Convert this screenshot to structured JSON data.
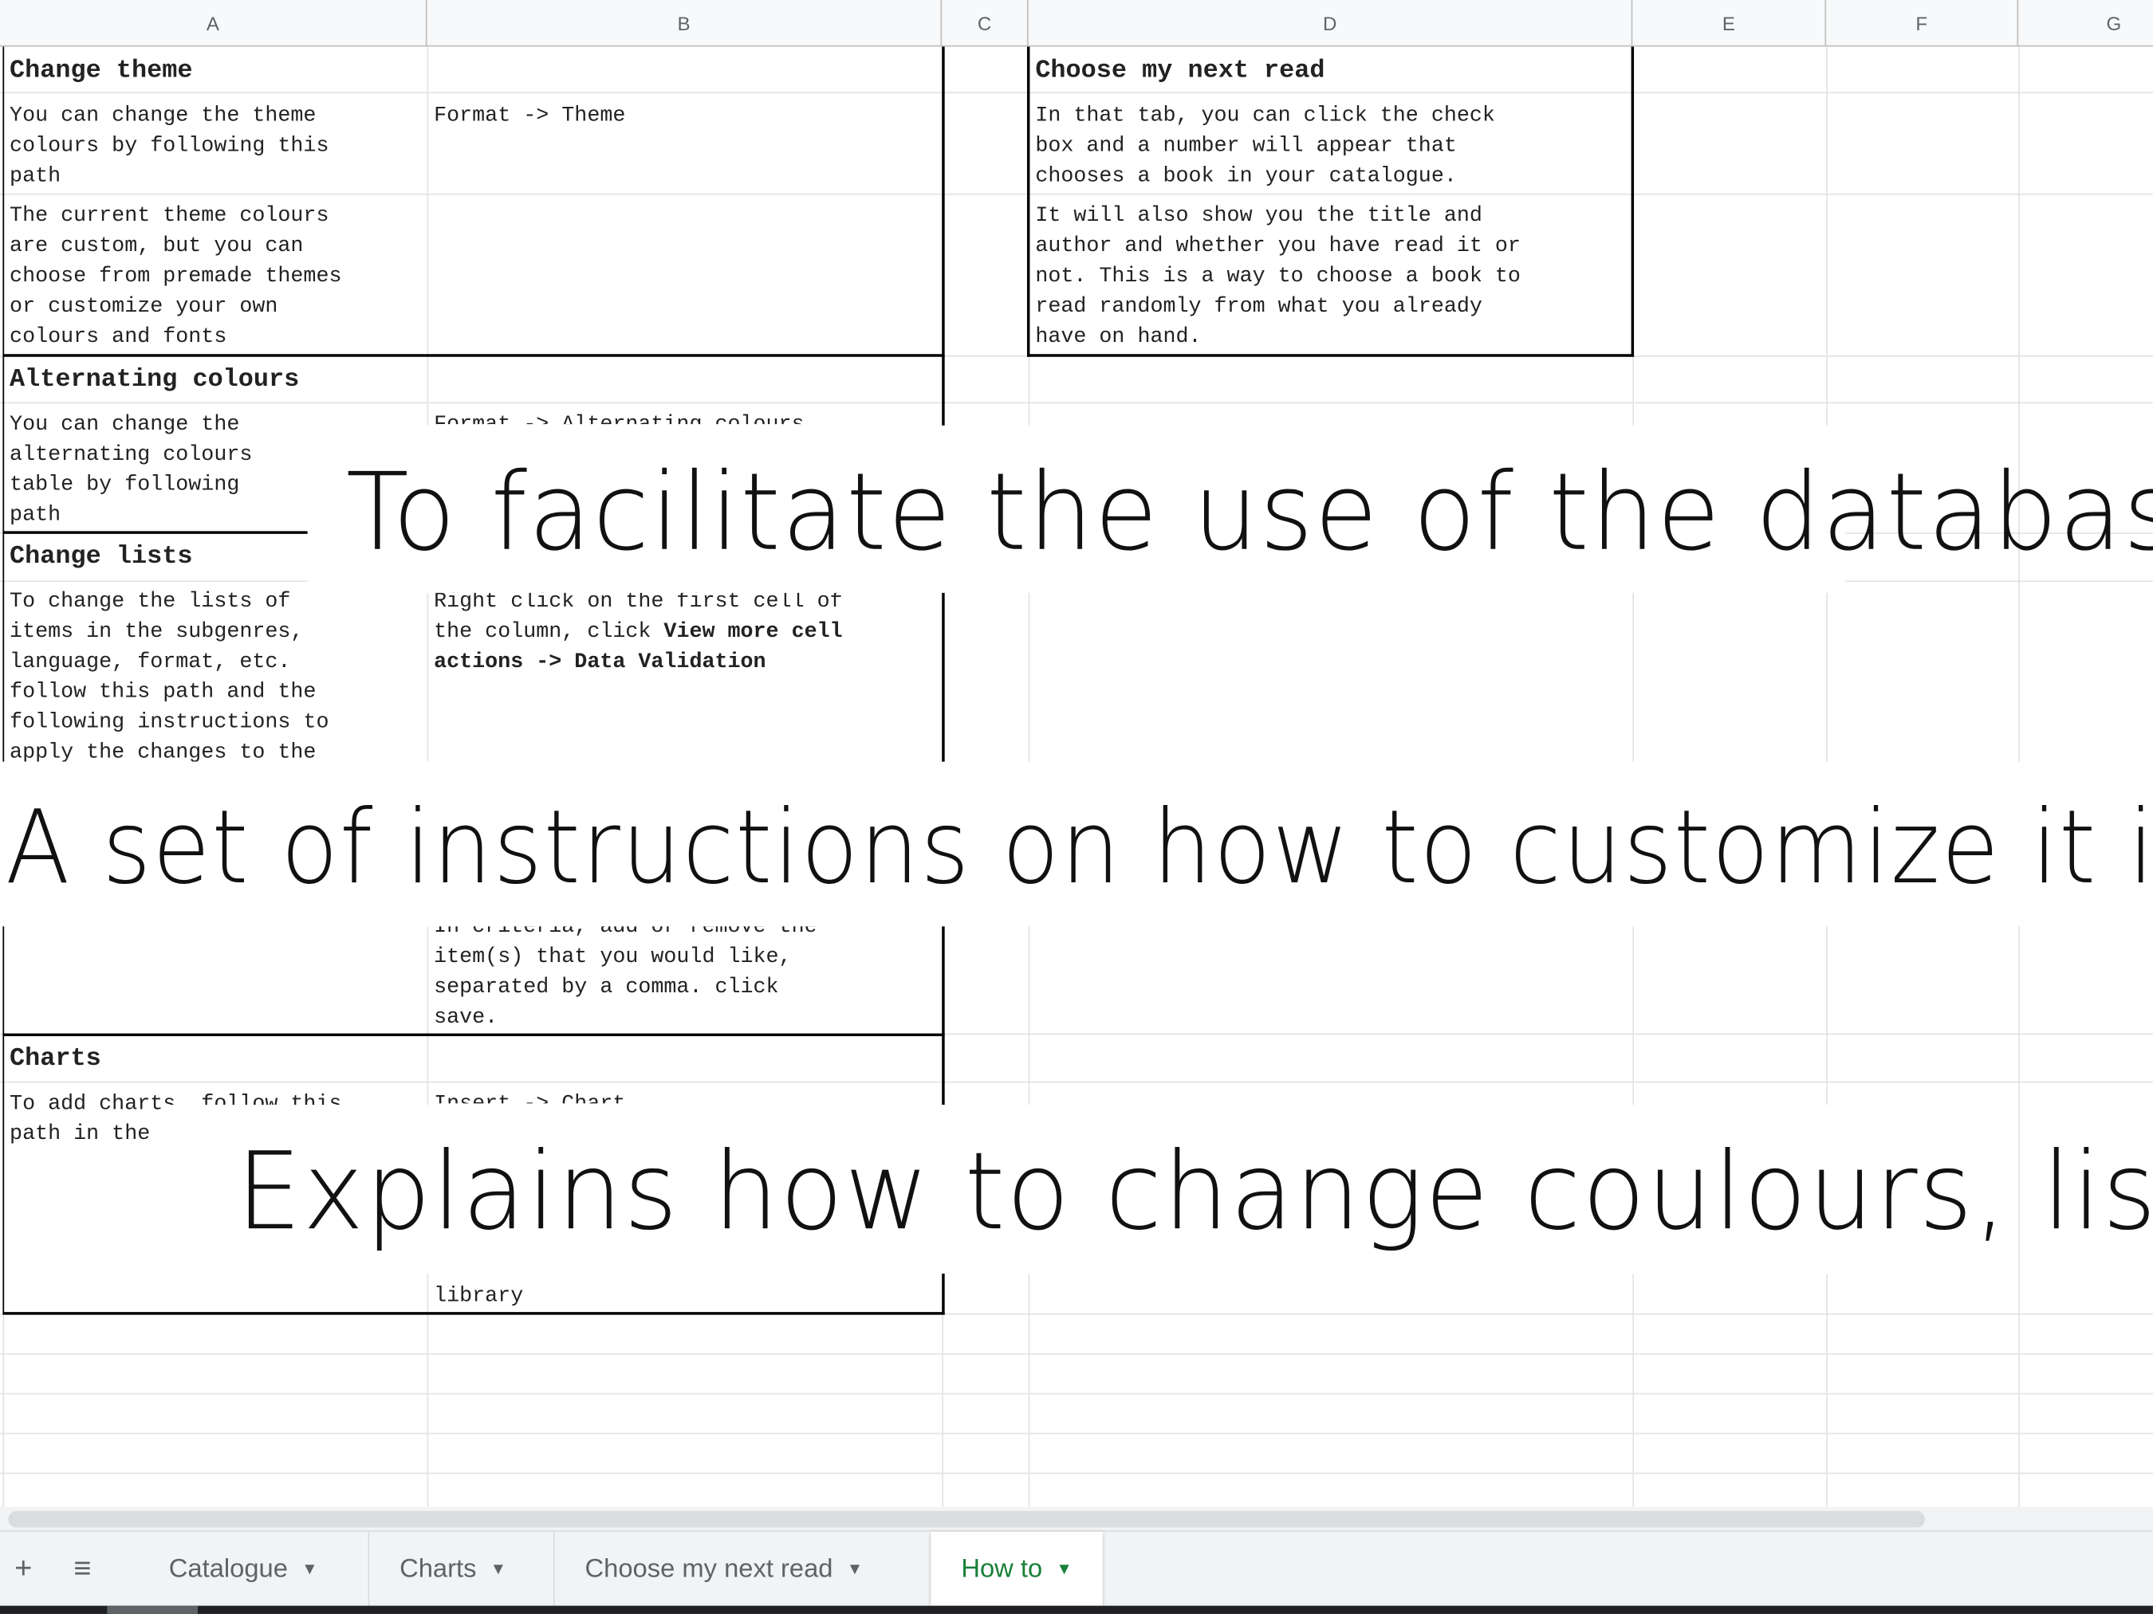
{
  "columns": [
    "A",
    "B",
    "C",
    "D",
    "E",
    "F",
    "G"
  ],
  "instructions": {
    "change_theme": {
      "heading": "Change theme",
      "desc": "You can change the theme\ncolours by following this\npath",
      "path": "Format -> Theme",
      "note": "The current theme colours\nare custom, but you can\nchoose from premade themes\nor customize your own\ncolours and fonts"
    },
    "alternating": {
      "heading": "Alternating colours",
      "desc": "You can change the\nalternating colours\ntable by following \npath",
      "path_fragment": "Format -> Alternating colours"
    },
    "change_lists": {
      "heading": "Change lists",
      "desc": "To change the lists of\nitems in the subgenres,\nlanguage, format, etc.\nfollow this path and the\nfollowing instructions to\napply the changes to the",
      "path_line1": "Right click on the first cell of\nthe column, click ",
      "path_bold1": "View more cell",
      "path_bold2": "actions -> Data Validation",
      "criteria": "In criteria, add or remove the\nitem(s) that you would like,\nseparated by a comma. click\nsave."
    },
    "charts": {
      "heading": "Charts",
      "desc": "To add charts, follow this\npath in the '",
      "path": "Insert -> Chart",
      "tail": "library"
    },
    "next_read": {
      "heading": "Choose my next read",
      "desc1": "In that tab, you can click the check\nbox and a number will appear that\nchooses a book in your catalogue.",
      "desc2": "It will also show you the title and\nauthor and whether you have read it or\nnot. This is a way to choose a book to\nread randomly from what you already\nhave on hand."
    }
  },
  "banners": {
    "line1": "To facilitate the use of the database",
    "line2": "A set of instructions on how to customize it is included",
    "line3": "Explains how to change coulours, lists, etc."
  },
  "sheet_tabs": [
    {
      "label": "Catalogue",
      "active": false
    },
    {
      "label": "Charts",
      "active": false
    },
    {
      "label": "Choose my next read",
      "active": false
    },
    {
      "label": "How to",
      "active": true
    }
  ],
  "icons": {
    "add": "plus-icon",
    "all_sheets": "list-icon",
    "caret": "caret-down-icon"
  },
  "colors": {
    "active_tab": "#188038",
    "header_bg": "#f8f9fa"
  }
}
